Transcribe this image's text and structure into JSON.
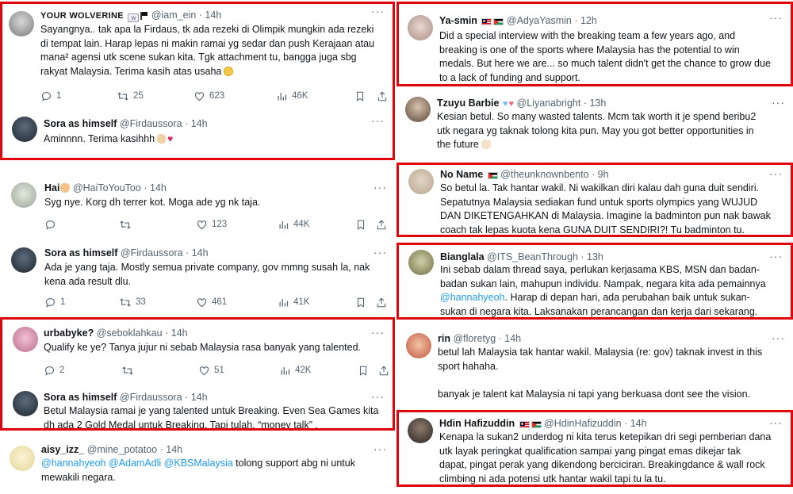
{
  "left": [
    {
      "name": "YOUR WOLVERINE",
      "handle": "@iam_ein",
      "time": "14h",
      "lines": [
        "Sayangnya.. tak apa la Firdaus, tk ada rezeki di Olimpik mungkin ada rezeki",
        "di tempat lain. Harap lepas ni makin ramai yg sedar dan push Kerajaan atau",
        "mana² agensi utk scene sukan kita. Tgk attachment tu, bangga juga sbg",
        "rakyat Malaysia. Terima kasih atas usaha"
      ],
      "stats": {
        "reply": "1",
        "retweet": "25",
        "like": "623",
        "views": "46K"
      }
    },
    {
      "name": "Sora as himself",
      "handle": "@Firdaussora",
      "time": "14h",
      "lines": [
        "Aminnnn. Terima kasihhh"
      ],
      "stats": {
        "reply": "",
        "retweet": "",
        "like": "",
        "views": ""
      }
    },
    {
      "name": "Hai",
      "handle": "@HaiToYouToo",
      "time": "14h",
      "lines": [
        "Syg nye. Korg dh terrer kot. Moga ade yg nk taja."
      ],
      "stats": {
        "reply": "",
        "retweet": "",
        "like": "123",
        "views": "44K"
      }
    },
    {
      "name": "Sora as himself",
      "handle": "@Firdaussora",
      "time": "14h",
      "lines": [
        "Ada je yang taja. Mostly semua private company, gov mmng susah la, nak",
        "kena ada result dlu."
      ],
      "stats": {
        "reply": "1",
        "retweet": "33",
        "like": "461",
        "views": "41K"
      }
    },
    {
      "name": "urbabyke?",
      "handle": "@seboklahkau",
      "time": "14h",
      "lines": [
        "Qualify ke ye? Tanya jujur ni sebab Malaysia rasa  banyak yang talented."
      ],
      "stats": {
        "reply": "2",
        "retweet": "",
        "like": "51",
        "views": "42K"
      }
    },
    {
      "name": "Sora as himself",
      "handle": "@Firdaussora",
      "time": "14h",
      "lines": [
        "Betul Malaysia ramai je yang talented untuk Breaking. Even Sea Games kita",
        "dh ada 2 Gold Medal untuk Breaking. Tapi tulah, “money talk” ."
      ],
      "stats": {
        "reply": "",
        "retweet": "",
        "like": "",
        "views": ""
      }
    },
    {
      "name": "aisy_izz_",
      "handle": "@mine_potatoo",
      "time": "14h",
      "mentions": [
        "@hannahyeoh",
        "@AdamAdli",
        "@KBSMalaysia"
      ],
      "lines": [
        " tolong support abg ni untuk",
        "mewakili negara."
      ],
      "stats": {
        "reply": "",
        "retweet": "",
        "like": "",
        "views": ""
      }
    }
  ],
  "right": [
    {
      "name": "Ya-smin",
      "handle": "@AdyaYasmin",
      "time": "12h",
      "lines": [
        "Did a special interview with the breaking team a few years ago, and",
        "breaking is one of the sports where Malaysia has the potential to win",
        "medals. But here we are... so much talent didn't get the chance to grow due",
        "to a lack of funding and support."
      ]
    },
    {
      "name": "Tzuyu Barbie",
      "handle": "@Liyanabright",
      "time": "13h",
      "lines": [
        "Kesian betul. So many wasted talents. Mcm tak worth it je spend beribu2",
        "utk negara yg taknak tolong kita pun. May you got better opportunities in",
        "the future"
      ]
    },
    {
      "name": "No Name",
      "handle": "@theunknownbento",
      "time": "9h",
      "lines": [
        "So betul la. Tak hantar wakil. Ni wakilkan diri kalau dah guna duit sendiri.",
        "Sepatutnya Malaysia sediakan fund untuk sports olympics yang WUJUD",
        "DAN DIKETENGAHKAN di Malaysia. Imagine la badminton pun nak bawak",
        "coach tak lepas kuota kena GUNA DUIT SENDIRI?! Tu badminton tu."
      ]
    },
    {
      "name": "Bianglala",
      "handle": "@ITS_BeanThrough",
      "time": "13h",
      "mention": "@hannahyeoh",
      "lines": [
        "Ini sebab dalam thread saya, perlukan  kerjasama KBS, MSN dan badan-",
        "badan sukan lain, mahupun individu. Nampak, negara kita ada pemainnya",
        ". Harap di depan hari, ada perubahan baik untuk sukan-",
        "sukan di negara kita. Laksanakan perancangan dan kerja dari sekarang."
      ]
    },
    {
      "name": "rin",
      "handle": "@floretyg",
      "time": "14h",
      "lines": [
        "betul lah Malaysia tak hantar wakil. Malaysia (re: gov) taknak invest in this",
        "sport hahaha.",
        "",
        "banyak je talent kat Malaysia ni tapi yang berkuasa dont see the vision."
      ]
    },
    {
      "name": "Hdin Hafizuddin",
      "handle": "@HdinHafizuddin",
      "time": "14h",
      "lines": [
        "Kenapa la sukan2 underdog ni kita terus ketepikan dri segi pemberian dana",
        "utk layak peringkat qualification sampai yang pingat emas dikejar tak",
        "dapat, pingat perak yang dikendong berciciran. Breakingdance & wall rock",
        "climbing ni ada potensi utk hantar wakil tapi tu la tu."
      ]
    }
  ],
  "colors": {
    "highlight_border": "#e0040b",
    "link": "#1d9bf0",
    "muted": "#536471"
  },
  "icons": [
    "reply-icon",
    "retweet-icon",
    "like-icon",
    "views-icon",
    "bookmark-icon",
    "share-icon",
    "more-icon"
  ]
}
